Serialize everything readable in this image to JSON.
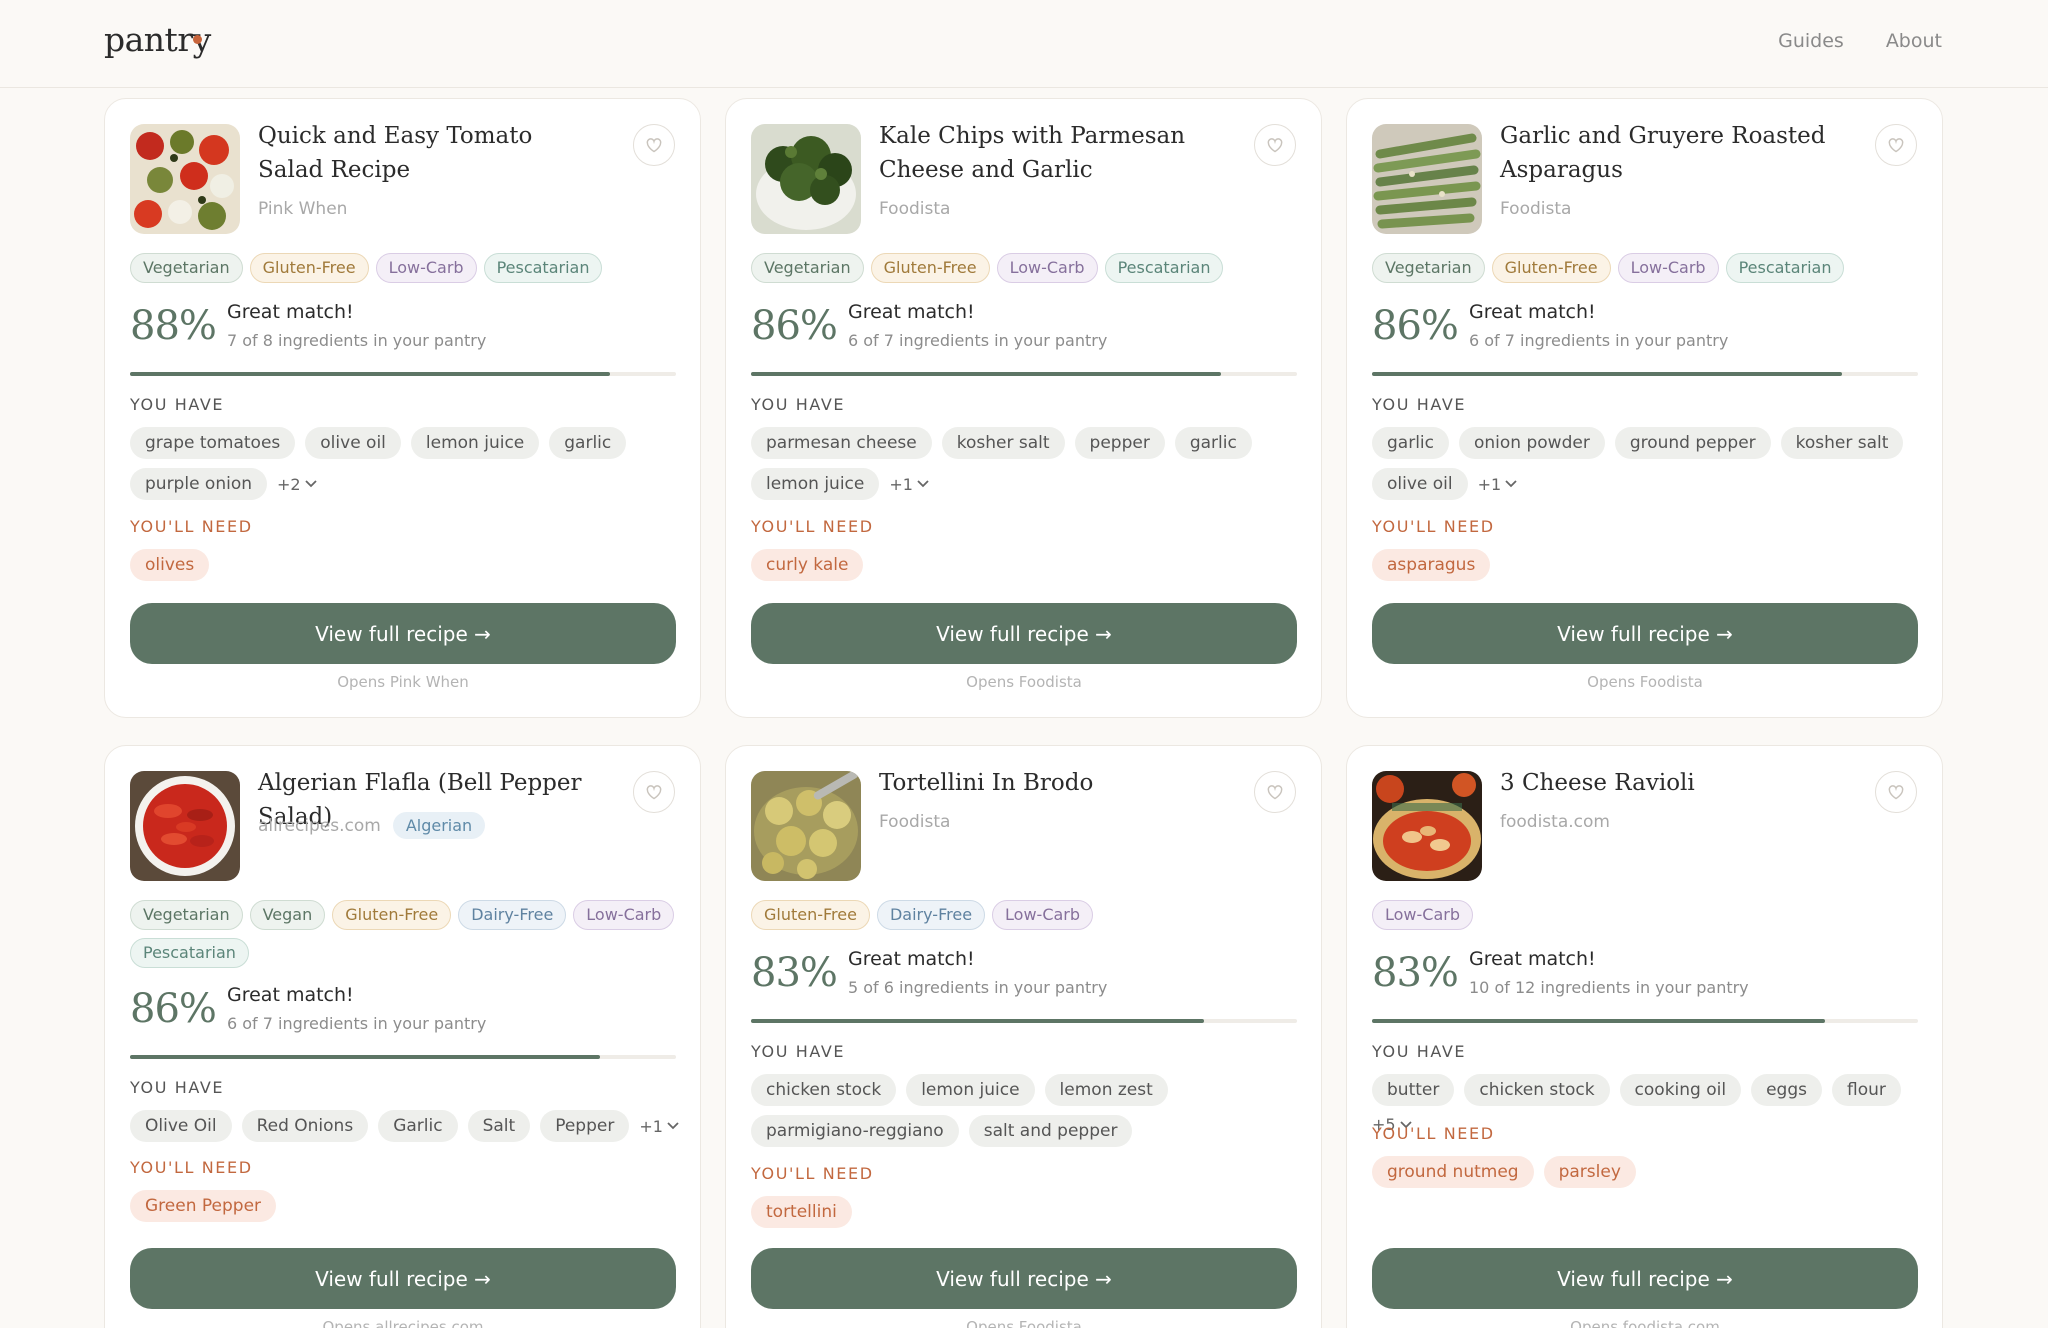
{
  "header": {
    "logo": "pantry",
    "nav": [
      "Guides",
      "About"
    ]
  },
  "colors": {
    "accent": "#5d7565",
    "need": "#c2683f",
    "logo_dot": "#c8643b"
  },
  "labels": {
    "you_have": "YOU HAVE",
    "youll_need": "YOU'LL NEED",
    "view_recipe": "View full recipe →"
  },
  "recipes": [
    {
      "title": "Quick and Easy Tomato Salad Recipe",
      "source": "Pink When",
      "cuisine": "",
      "tags": [
        "Vegetarian",
        "Gluten-Free",
        "Low-Carb",
        "Pescatarian"
      ],
      "match_percent": "88%",
      "match_label": "Great match!",
      "match_detail": "7 of 8 ingredients in your pantry",
      "progress": 0.88,
      "have": [
        "grape tomatoes",
        "olive oil",
        "lemon juice",
        "garlic",
        "purple onion"
      ],
      "have_more": "+2",
      "need": [
        "olives"
      ],
      "opens": "Opens Pink When",
      "image_icon": "tomato-salad-photo"
    },
    {
      "title": "Kale Chips with Parmesan Cheese and Garlic",
      "source": "Foodista",
      "cuisine": "",
      "tags": [
        "Vegetarian",
        "Gluten-Free",
        "Low-Carb",
        "Pescatarian"
      ],
      "match_percent": "86%",
      "match_label": "Great match!",
      "match_detail": "6 of 7 ingredients in your pantry",
      "progress": 0.86,
      "have": [
        "parmesan cheese",
        "kosher salt",
        "pepper",
        "garlic",
        "lemon juice"
      ],
      "have_more": "+1",
      "need": [
        "curly kale"
      ],
      "opens": "Opens Foodista",
      "image_icon": "kale-chips-photo"
    },
    {
      "title": "Garlic and Gruyere Roasted Asparagus",
      "source": "Foodista",
      "cuisine": "",
      "tags": [
        "Vegetarian",
        "Gluten-Free",
        "Low-Carb",
        "Pescatarian"
      ],
      "match_percent": "86%",
      "match_label": "Great match!",
      "match_detail": "6 of 7 ingredients in your pantry",
      "progress": 0.86,
      "have": [
        "garlic",
        "onion powder",
        "ground pepper",
        "kosher salt",
        "olive oil"
      ],
      "have_more": "+1",
      "need": [
        "asparagus"
      ],
      "opens": "Opens Foodista",
      "image_icon": "asparagus-photo"
    },
    {
      "title": "Algerian Flafla (Bell Pepper Salad)",
      "source": "allrecipes.com",
      "cuisine": "Algerian",
      "tags": [
        "Vegetarian",
        "Vegan",
        "Gluten-Free",
        "Dairy-Free",
        "Low-Carb",
        "Pescatarian"
      ],
      "match_percent": "86%",
      "match_label": "Great match!",
      "match_detail": "6 of 7 ingredients in your pantry",
      "progress": 0.86,
      "have": [
        "Olive Oil",
        "Red Onions",
        "Garlic",
        "Salt",
        "Pepper"
      ],
      "have_more": "+1",
      "need": [
        "Green Pepper"
      ],
      "opens": "Opens allrecipes.com",
      "image_icon": "pepper-salad-photo"
    },
    {
      "title": "Tortellini In Brodo",
      "source": "Foodista",
      "cuisine": "",
      "tags": [
        "Gluten-Free",
        "Dairy-Free",
        "Low-Carb"
      ],
      "match_percent": "83%",
      "match_label": "Great match!",
      "match_detail": "5 of 6 ingredients in your pantry",
      "progress": 0.83,
      "have": [
        "chicken stock",
        "lemon juice",
        "lemon zest",
        "parmigiano-reggiano",
        "salt and pepper"
      ],
      "have_more": "",
      "need": [
        "tortellini"
      ],
      "opens": "Opens Foodista",
      "image_icon": "tortellini-photo"
    },
    {
      "title": "3 Cheese Ravioli",
      "source": "foodista.com",
      "cuisine": "",
      "tags": [
        "Low-Carb"
      ],
      "match_percent": "83%",
      "match_label": "Great match!",
      "match_detail": "10 of 12 ingredients in your pantry",
      "progress": 0.83,
      "have": [
        "butter",
        "chicken stock",
        "cooking oil",
        "eggs",
        "flour"
      ],
      "have_more": "+5",
      "need": [
        "ground nutmeg",
        "parsley"
      ],
      "opens": "Opens foodista.com",
      "image_icon": "ravioli-photo"
    }
  ]
}
